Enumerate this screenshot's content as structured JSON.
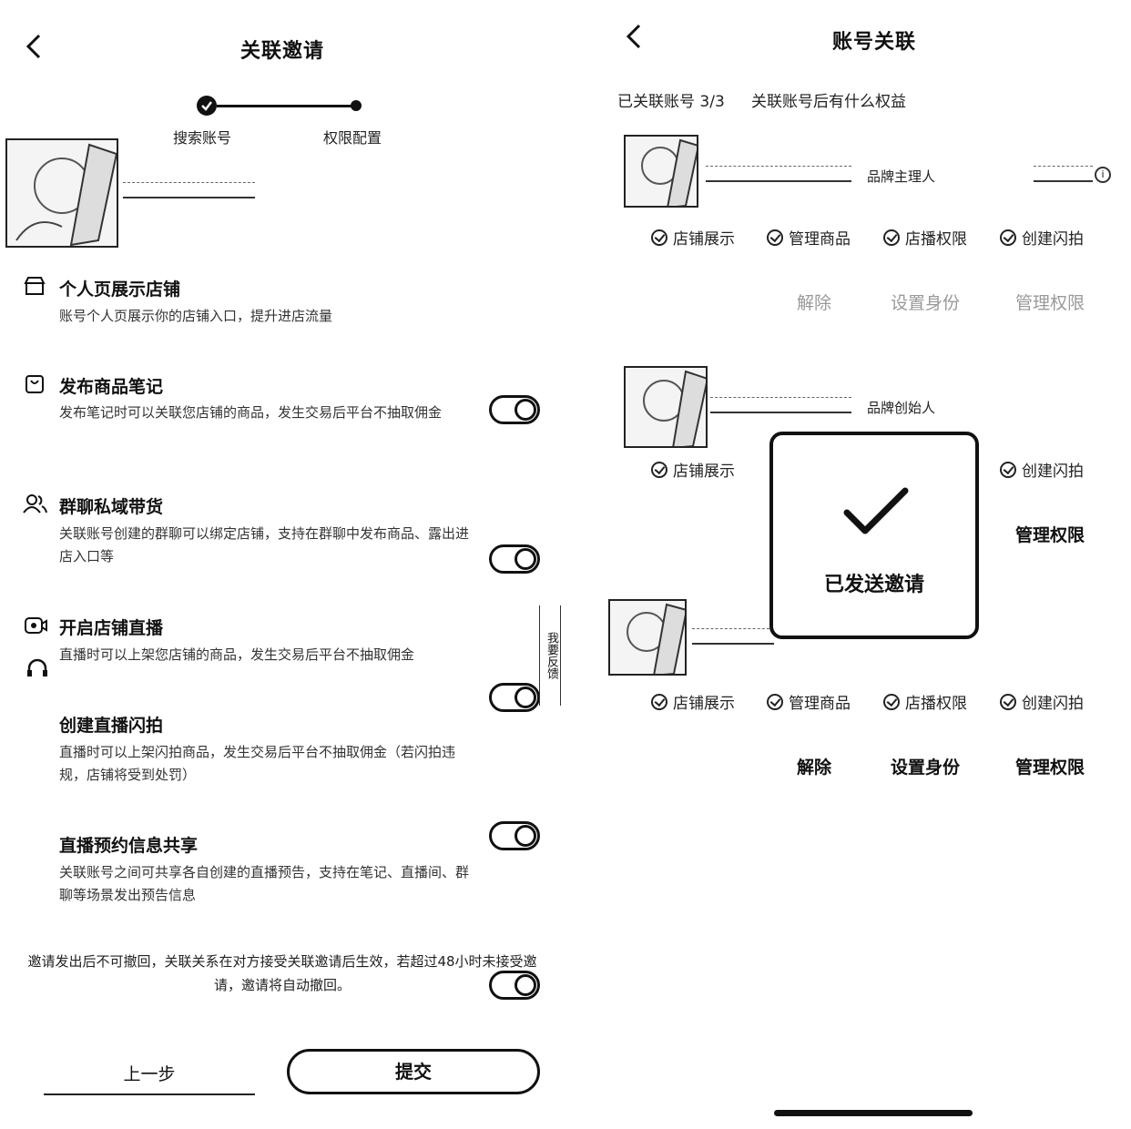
{
  "left": {
    "title": "关联邀请",
    "steps": [
      "搜索账号",
      "权限配置"
    ],
    "permissions": [
      {
        "icon": "store-icon",
        "title": "个人页展示店铺",
        "desc": "账号个人页展示你的店铺入口，提升进店流量",
        "toggle": false
      },
      {
        "icon": "note-icon",
        "title": "发布商品笔记",
        "desc": "发布笔记时可以关联您店铺的商品，发生交易后平台不抽取佣金",
        "toggle": true
      },
      {
        "icon": "group-icon",
        "title": "群聊私域带货",
        "desc": "关联账号创建的群聊可以绑定店铺，支持在群聊中发布商品、露出进店入口等",
        "toggle": true
      },
      {
        "icon": "live-icon",
        "title": "开启店铺直播",
        "desc": "直播时可以上架您店铺的商品，发生交易后平台不抽取佣金",
        "toggle": true
      },
      {
        "icon": "",
        "title": "创建直播闪拍",
        "desc": "直播时可以上架闪拍商品，发生交易后平台不抽取佣金（若闪拍违规，店铺将受到处罚）",
        "toggle": true
      },
      {
        "icon": "",
        "title": "直播预约信息共享",
        "desc": "关联账号之间可共享各自创建的直播预告，支持在笔记、直播间、群聊等场景发出预告信息",
        "toggle": true
      }
    ],
    "notice": "邀请发出后不可撤回，关联关系在对方接受关联邀请后生效，若超过48小时未接受邀请，邀请将自动撤回。",
    "prev_label": "上一步",
    "submit_label": "提交",
    "side_tab": "我要反馈"
  },
  "right": {
    "title": "账号关联",
    "count": "已关联账号 3/3",
    "question": "关联账号后有什么权益",
    "accounts": [
      {
        "role": "品牌主理人",
        "perms": [
          "店铺展示",
          "管理商品",
          "店播权限",
          "创建闪拍"
        ],
        "actions": [
          "解除",
          "设置身份",
          "管理权限"
        ],
        "faded": true
      },
      {
        "role": "品牌创始人",
        "perms": [
          "店铺展示",
          "创建闪拍"
        ],
        "actions": [
          "管理权限"
        ],
        "faded": false
      },
      {
        "role": "",
        "perms": [
          "店铺展示",
          "管理商品",
          "店播权限",
          "创建闪拍"
        ],
        "actions": [
          "解除",
          "设置身份",
          "管理权限"
        ],
        "faded": false
      }
    ],
    "toast": "已发送邀请",
    "badge": "i"
  }
}
